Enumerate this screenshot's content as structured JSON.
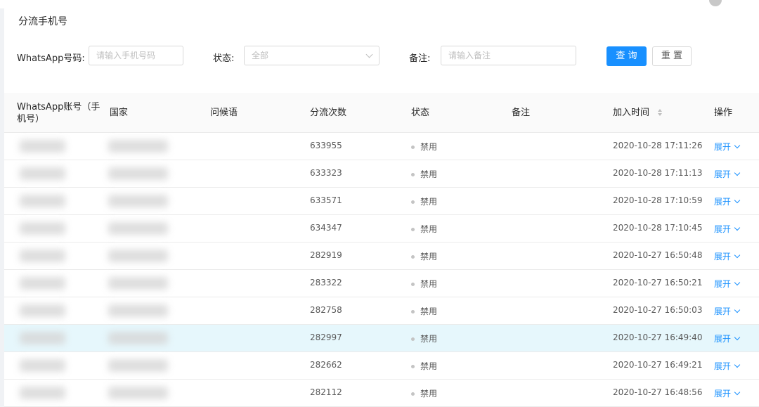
{
  "page": {
    "title": "分流手机号"
  },
  "filters": {
    "whatsapp_label": "WhatsApp号码:",
    "whatsapp_placeholder": "请输入手机号码",
    "status_label": "状态:",
    "status_value": "全部",
    "remark_label": "备注:",
    "remark_placeholder": "请输入备注",
    "query_button": "查 询",
    "reset_button": "重 置"
  },
  "table": {
    "headers": [
      "WhatsApp账号（手机号）",
      "国家",
      "问候语",
      "分流次数",
      "状态",
      "备注",
      "加入时间",
      "操作"
    ],
    "header_account_line1": "WhatsApp账号（手",
    "header_account_line2": "机号）",
    "rows": [
      {
        "count": "633955",
        "status": "禁用",
        "time": "2020-10-28 17:11:26",
        "action": "展开"
      },
      {
        "count": "633323",
        "status": "禁用",
        "time": "2020-10-28 17:11:13",
        "action": "展开"
      },
      {
        "count": "633571",
        "status": "禁用",
        "time": "2020-10-28 17:10:59",
        "action": "展开"
      },
      {
        "count": "634347",
        "status": "禁用",
        "time": "2020-10-28 17:10:45",
        "action": "展开"
      },
      {
        "count": "282919",
        "status": "禁用",
        "time": "2020-10-27 16:50:48",
        "action": "展开"
      },
      {
        "count": "283322",
        "status": "禁用",
        "time": "2020-10-27 16:50:21",
        "action": "展开"
      },
      {
        "count": "282758",
        "status": "禁用",
        "time": "2020-10-27 16:50:03",
        "action": "展开"
      },
      {
        "count": "282997",
        "status": "禁用",
        "time": "2020-10-27 16:49:40",
        "action": "展开"
      },
      {
        "count": "282662",
        "status": "禁用",
        "time": "2020-10-27 16:49:21",
        "action": "展开"
      },
      {
        "count": "282112",
        "status": "禁用",
        "time": "2020-10-27 16:48:56",
        "action": "展开"
      }
    ],
    "selected_row": 7
  },
  "colors": {
    "primary": "#1890ff",
    "selected_row": "#e6f7fc",
    "header_bg": "#fafafa"
  }
}
